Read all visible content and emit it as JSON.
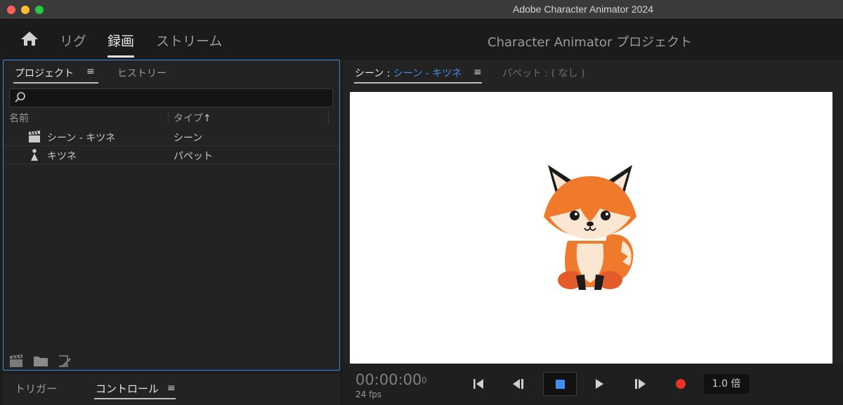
{
  "window": {
    "title": "Adobe Character Animator 2024"
  },
  "header": {
    "home_icon": "home-icon",
    "modes": [
      {
        "label": "リグ",
        "active": false
      },
      {
        "label": "録画",
        "active": true
      },
      {
        "label": "ストリーム",
        "active": false
      }
    ],
    "project_title": "Character Animator プロジェクト"
  },
  "left_panel": {
    "tabs": [
      {
        "label": "プロジェクト",
        "active": true
      },
      {
        "label": "ヒストリー",
        "active": false
      }
    ],
    "menu_icon": "≡",
    "search": {
      "placeholder": "",
      "value": ""
    },
    "columns": {
      "name": "名前",
      "type": "タイプ",
      "sort_icon": "↑"
    },
    "rows": [
      {
        "name": "シーン - キツネ",
        "type": "シーン",
        "icon": "scene-clapper-icon"
      },
      {
        "name": "キツネ",
        "type": "パペット",
        "icon": "puppet-icon"
      }
    ],
    "bottom_icons": [
      "new-scene-icon",
      "folder-icon",
      "edit-icon"
    ]
  },
  "bottom_left": {
    "tabs": [
      {
        "label": "トリガー",
        "active": false
      },
      {
        "label": "コントロール",
        "active": true
      }
    ],
    "menu_icon": "≡"
  },
  "scene_panel": {
    "scene_prefix": "シーン : ",
    "scene_name": "シーン - キツネ",
    "menu_icon": "≡",
    "puppet_tab": "パペット : ( なし )",
    "accent_color": "#3e8ef0"
  },
  "transport": {
    "timecode": "00:00:00",
    "frame": "0",
    "fps": "24 fps",
    "speed": "1.0 倍",
    "record_color": "#e9322a"
  }
}
